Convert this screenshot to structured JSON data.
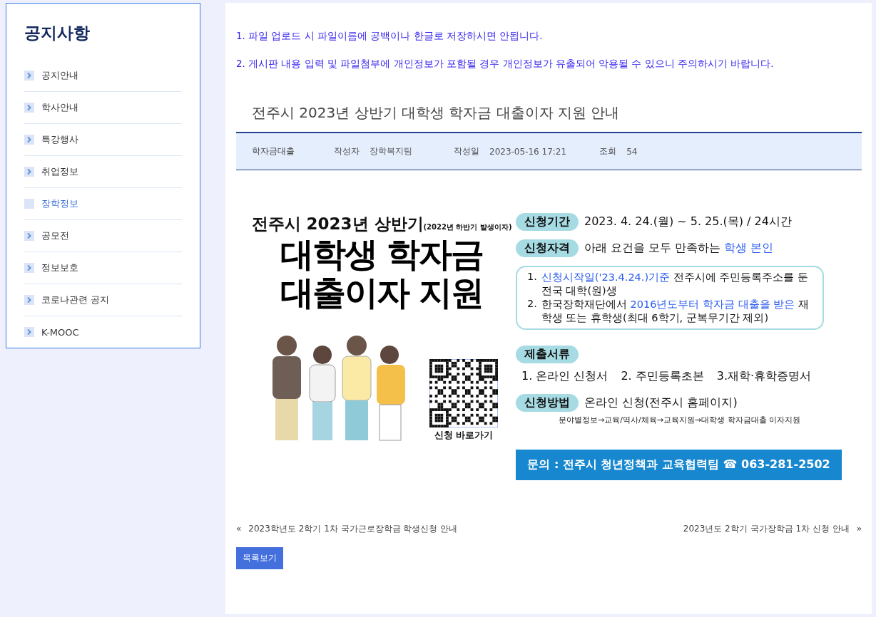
{
  "sidebar": {
    "title": "공지사항",
    "items": [
      {
        "label": "공지안내",
        "selected": false
      },
      {
        "label": "학사안내",
        "selected": false
      },
      {
        "label": "특강행사",
        "selected": false
      },
      {
        "label": "취업정보",
        "selected": false
      },
      {
        "label": "장학정보",
        "selected": true
      },
      {
        "label": "공모전",
        "selected": false
      },
      {
        "label": "정보보호",
        "selected": false
      },
      {
        "label": "코로나관련 공지",
        "selected": false
      },
      {
        "label": "K-MOOC",
        "selected": false
      }
    ]
  },
  "notices": [
    "1. 파일 업로드 시 파일이름에 공백이나 한글로 저장하시면 안됩니다.",
    "2. 게시판 내용 입력 및 파일첨부에 개인정보가 포함될 경우 개인정보가 유출되어 악용될 수 있으니 주의하시기 바랍니다."
  ],
  "post": {
    "title": "전주시 2023년 상반기 대학생 학자금 대출이자 지원 안내",
    "category": "학자금대출",
    "author_label": "작성자",
    "author": "장학복지팀",
    "date_label": "작성일",
    "date": "2023-05-16 17:21",
    "views_label": "조회",
    "views": "54"
  },
  "poster": {
    "headline_top": "전주시 2023년 상반기",
    "headline_note": "(2022년 하반기 발생이자)",
    "headline_main": [
      "대학생 학자금",
      "대출이자 지원"
    ],
    "qr_caption": "신청 바로가기",
    "sections": [
      {
        "kind": "line",
        "tag": "신청기간",
        "segments": [
          {
            "text": "2023. 4. 24.(월) ~ 5. 25.(목)  / 24시간",
            "highlight": false
          }
        ]
      },
      {
        "kind": "line",
        "tag": "신청자격",
        "segments": [
          {
            "text": "아래 요건을 모두 만족하는 ",
            "highlight": false
          },
          {
            "text": "학생 본인",
            "highlight": true
          }
        ]
      },
      {
        "kind": "criteria",
        "items": [
          {
            "number": "1.",
            "segments": [
              {
                "text": "신청시작일('23.4.24.)기준",
                "highlight": true
              },
              {
                "text": " 전주시에 주민등록주소를 둔 전국 대학(원)생",
                "highlight": false
              }
            ]
          },
          {
            "number": "2.",
            "segments": [
              {
                "text": "한국장학재단에서 ",
                "highlight": false
              },
              {
                "text": "2016년도부터 학자금 대출을 받은",
                "highlight": true
              },
              {
                "text": " 재학생 또는 휴학생(최대 6학기, 군복무기간 제외)",
                "highlight": false
              }
            ]
          }
        ]
      },
      {
        "kind": "documents",
        "tag": "제출서류",
        "items": [
          "1. 온라인 신청서",
          "2. 주민등록초본",
          "3.재학·휴학증명서"
        ]
      },
      {
        "kind": "method",
        "tag": "신청방법",
        "text": "온라인 신청(전주시 홈페이지)",
        "path": "분야별정보→교육/역사/체육→교육지원→대학생 학자금대출 이자지원"
      }
    ],
    "contact": "문의 : 전주시 청년정책과 교육협력팀  ☎ 063-281-2502"
  },
  "nav": {
    "prev_mark": "«",
    "prev": "2023학년도 2학기 1차 국가근로장학금 학생신청 안내",
    "next": "2023년도 2학기 국가장학금 1차 신청 안내",
    "next_mark": "»"
  },
  "list_button": "목록보기"
}
